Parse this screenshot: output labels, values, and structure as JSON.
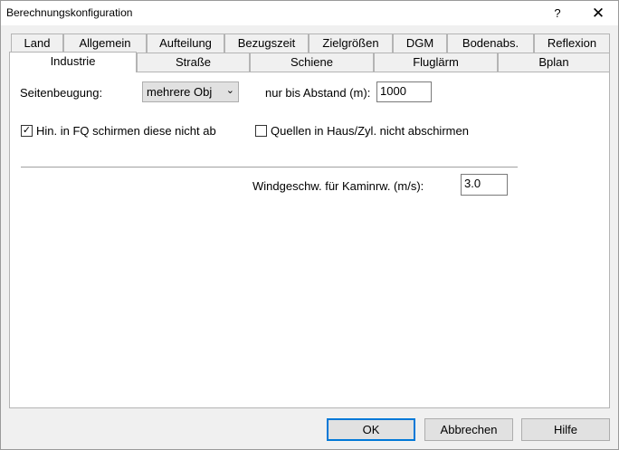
{
  "window": {
    "title": "Berechnungskonfiguration",
    "help_glyph": "?",
    "close_glyph": "✕"
  },
  "tabs_row1": [
    "Land",
    "Allgemein",
    "Aufteilung",
    "Bezugszeit",
    "Zielgrößen",
    "DGM",
    "Bodenabs.",
    "Reflexion"
  ],
  "tabs_row2": [
    "Industrie",
    "Straße",
    "Schiene",
    "Fluglärm",
    "Bplan"
  ],
  "active_tab": "Industrie",
  "form": {
    "seitenbeugung_label": "Seitenbeugung:",
    "seitenbeugung_value": "mehrere Obj",
    "abstand_label": "nur bis Abstand (m):",
    "abstand_value": "1000",
    "hin_label": "Hin. in FQ schirmen diese nicht ab",
    "hin_checked": true,
    "quellen_label": "Quellen in Haus/Zyl. nicht abschirmen",
    "quellen_checked": false,
    "wind_label": "Windgeschw. für Kaminrw. (m/s):",
    "wind_value": "3.0",
    "check_glyph": "✓"
  },
  "buttons": {
    "ok": "OK",
    "cancel": "Abbrechen",
    "help": "Hilfe"
  }
}
